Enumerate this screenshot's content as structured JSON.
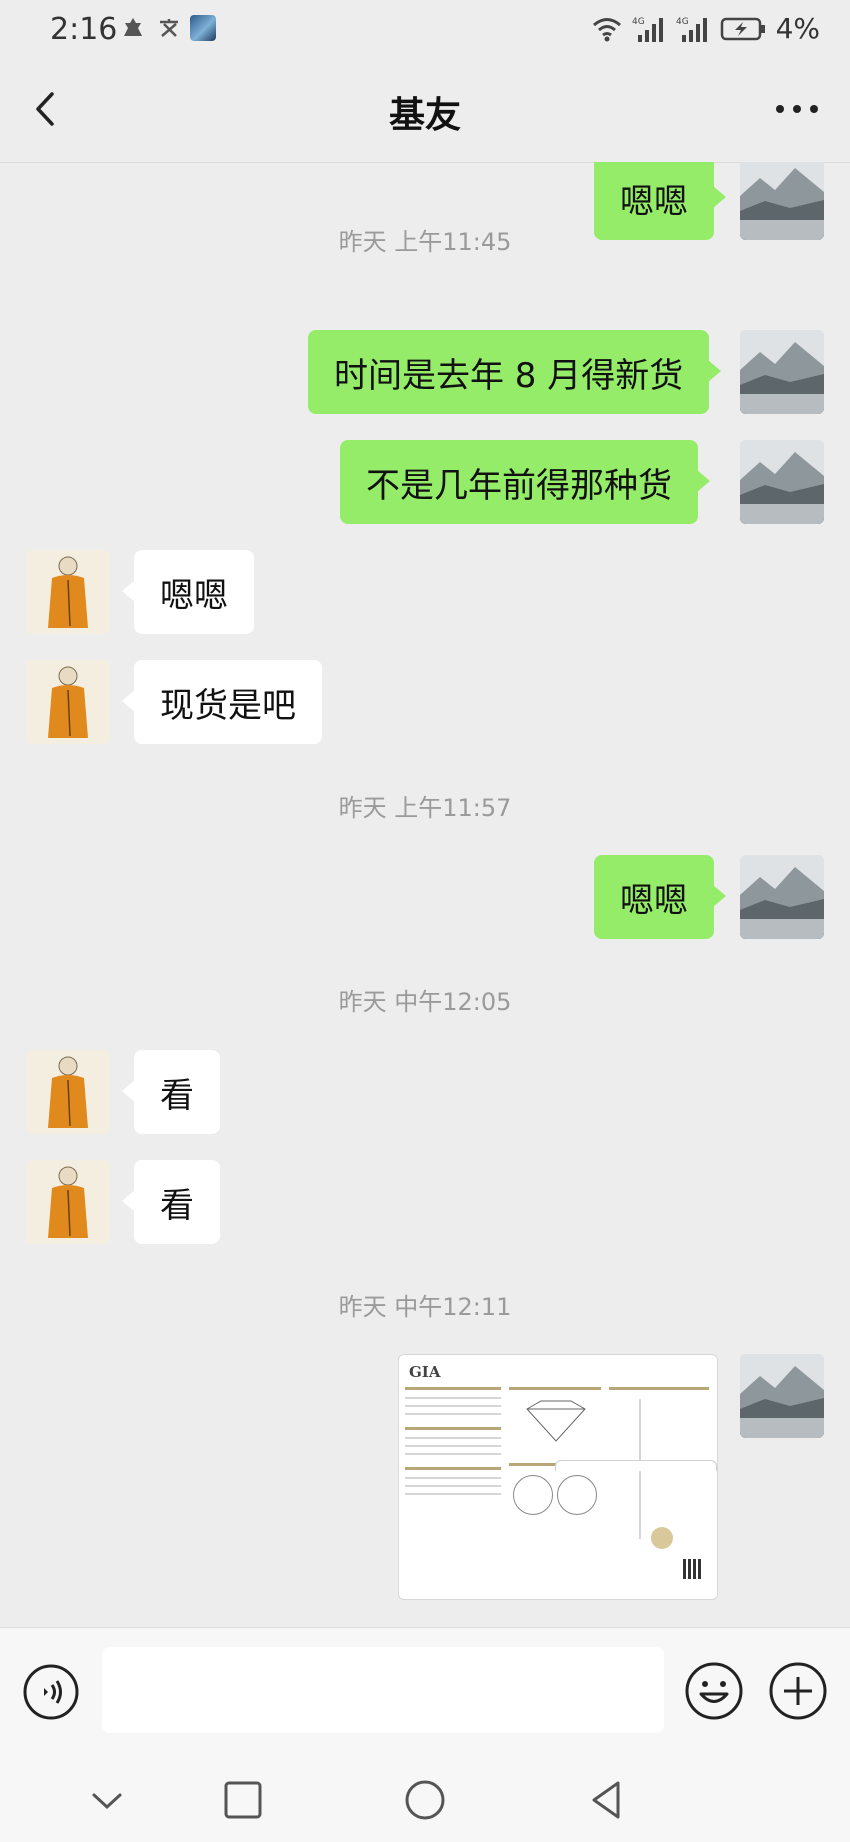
{
  "status_bar": {
    "time": "2:16",
    "left_icons": [
      "buddha-icon",
      "text-icon",
      "gallery-app-icon"
    ],
    "right_icons": [
      "wifi-icon",
      "signal-4g-icon",
      "signal-4g-icon",
      "battery-charging-icon"
    ],
    "battery_percent": "4%",
    "signal_label_1": "4G",
    "signal_label_2": "4G"
  },
  "header": {
    "title": "基友",
    "back_icon": "chevron-left-icon",
    "more_icon": "more-horizontal-icon"
  },
  "messages": [
    {
      "type": "text",
      "sender": "me",
      "text": "嗯嗯"
    },
    {
      "type": "timestamp",
      "text": "昨天 上午11:45"
    },
    {
      "type": "text",
      "sender": "me",
      "text": "时间是去年 8 月得新货"
    },
    {
      "type": "text",
      "sender": "me",
      "text": "不是几年前得那种货"
    },
    {
      "type": "text",
      "sender": "them",
      "text": "嗯嗯"
    },
    {
      "type": "text",
      "sender": "them",
      "text": "现货是吧"
    },
    {
      "type": "timestamp",
      "text": "昨天 上午11:57"
    },
    {
      "type": "text",
      "sender": "me",
      "text": "嗯嗯"
    },
    {
      "type": "timestamp",
      "text": "昨天 中午12:05"
    },
    {
      "type": "text",
      "sender": "them",
      "text": "看"
    },
    {
      "type": "text",
      "sender": "them",
      "text": "看"
    },
    {
      "type": "timestamp",
      "text": "昨天 中午12:11"
    },
    {
      "type": "image",
      "sender": "me",
      "logo_text": "GIA"
    }
  ],
  "input_bar": {
    "value": "",
    "placeholder": "",
    "voice_icon": "voice-icon",
    "emoji_icon": "emoji-icon",
    "plus_icon": "plus-circle-icon"
  },
  "nav_bar": {
    "icons": [
      "chevron-down-icon",
      "square-icon",
      "circle-icon",
      "triangle-back-icon"
    ]
  },
  "colors": {
    "chat_background": "#ededed",
    "my_bubble": "#95ec69",
    "their_bubble": "#ffffff",
    "timestamp_text": "#9a9a9a"
  }
}
